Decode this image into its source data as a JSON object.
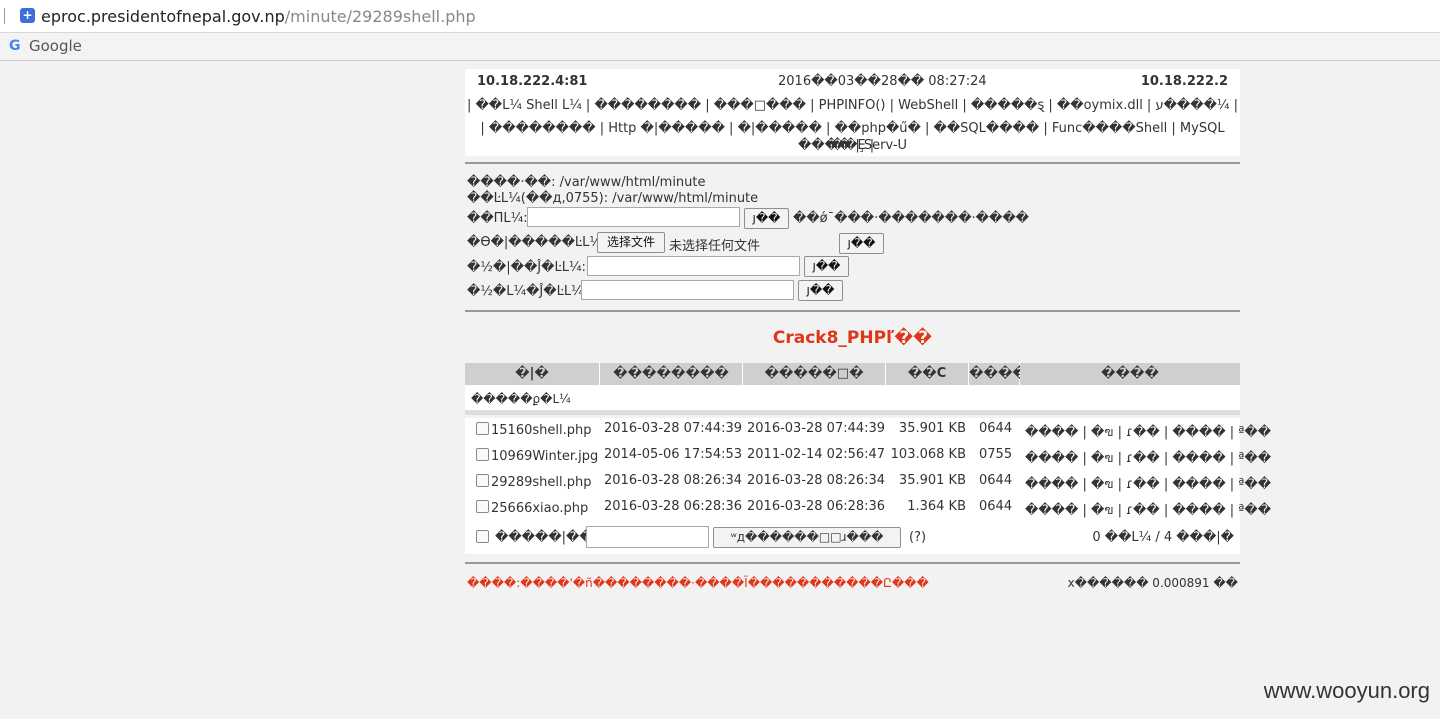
{
  "browser": {
    "url_host": "eproc.presidentofnepal.gov.np",
    "url_path": "/minute/29289shell.php",
    "bookmark_label": "Google"
  },
  "header": {
    "server_ip": "10.18.222.4:81",
    "datetime": "2016��03��28�� 08:27:24",
    "client_ip": "10.18.222.2",
    "nav_line1": "| ��L¼ Shell L¼ | �������� | ���□��� | PHPINFO() | WebShell | �����ȿ | ��oymix.dll | ע����¼ |",
    "nav_line2": "| �������� | Http �|����� | �|����� | ��php�ű� | ��SQL���� | Func����Shell | MySQL ���� | Serv-U",
    "nav_line3": "��Ȩ |"
  },
  "form": {
    "current_dir": "����·��: /var/www/html/minute",
    "perm_dir": "��ĿL¼(��д,0755): /var/www/html/minute",
    "newdir_label": "��ΠL¼:",
    "submit": "ȷ��",
    "newdir_hint": "��ǿ¯���·�������·����",
    "upload_label": "�ϴ�|�����ĿL¼:",
    "choose_file": "选择文件",
    "no_file": "未选择任何文件",
    "edit_label": "�½�|��Ĵ�ĿL¼:",
    "editdir_label": "�½�L¼�Ĵ�ĿL¼:"
  },
  "title": "Crack8_PHPľ��",
  "table": {
    "headers": [
      "�|�",
      "��������",
      "�����□�",
      "��С",
      "����",
      "����"
    ],
    "updir": "�����ϼ�L¼",
    "rows": [
      {
        "name": "15160shell.php",
        "ctime": "2016-03-28 07:44:39",
        "mtime": "2016-03-28 07:44:39",
        "size": "35.901 KB",
        "perm": "0644",
        "actions": "���� | �ฃ | ɾ�� | ���� | ª��"
      },
      {
        "name": "10969Winter.jpg",
        "ctime": "2014-05-06 17:54:53",
        "mtime": "2011-02-14 02:56:47",
        "size": "103.068 KB",
        "perm": "0755",
        "actions": "���� | �ฃ | ɾ�� | ���� | ª��"
      },
      {
        "name": "29289shell.php",
        "ctime": "2016-03-28 08:26:34",
        "mtime": "2016-03-28 08:26:34",
        "size": "35.901 KB",
        "perm": "0644",
        "actions": "���� | �ฃ | ɾ�� | ���� | ª��"
      },
      {
        "name": "25666xiao.php",
        "ctime": "2016-03-28 06:28:36",
        "mtime": "2016-03-28 06:28:36",
        "size": "1.364 KB",
        "perm": "0644",
        "actions": "���� | �ฃ | ɾ�� | ���� | ª��"
      }
    ],
    "bulk_label": "�����|���",
    "bulk_button": "ʷд������□□ɹ���",
    "help": "(?)",
    "count": "0 ��L¼ / 4 ���|�"
  },
  "footer": {
    "left": "����:����'�ñ��������·����Ï�����������Ը���",
    "right": "x������ 0.000891 ��"
  },
  "watermark": "www.wooyun.org"
}
